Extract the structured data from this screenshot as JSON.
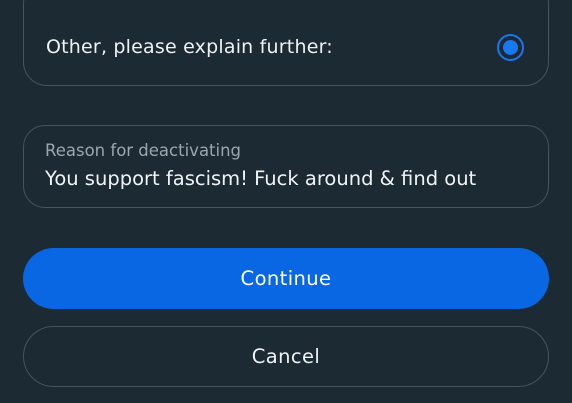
{
  "option": {
    "label": "Other, please explain further:",
    "selected": true
  },
  "reason_field": {
    "label": "Reason for deactivating",
    "value": "You support fascism! Fuck around & find out"
  },
  "buttons": {
    "continue_label": "Continue",
    "cancel_label": "Cancel"
  },
  "colors": {
    "background": "#1c2a33",
    "accent": "#0a67e3",
    "radio": "#1877f2",
    "border": "#46545d"
  }
}
